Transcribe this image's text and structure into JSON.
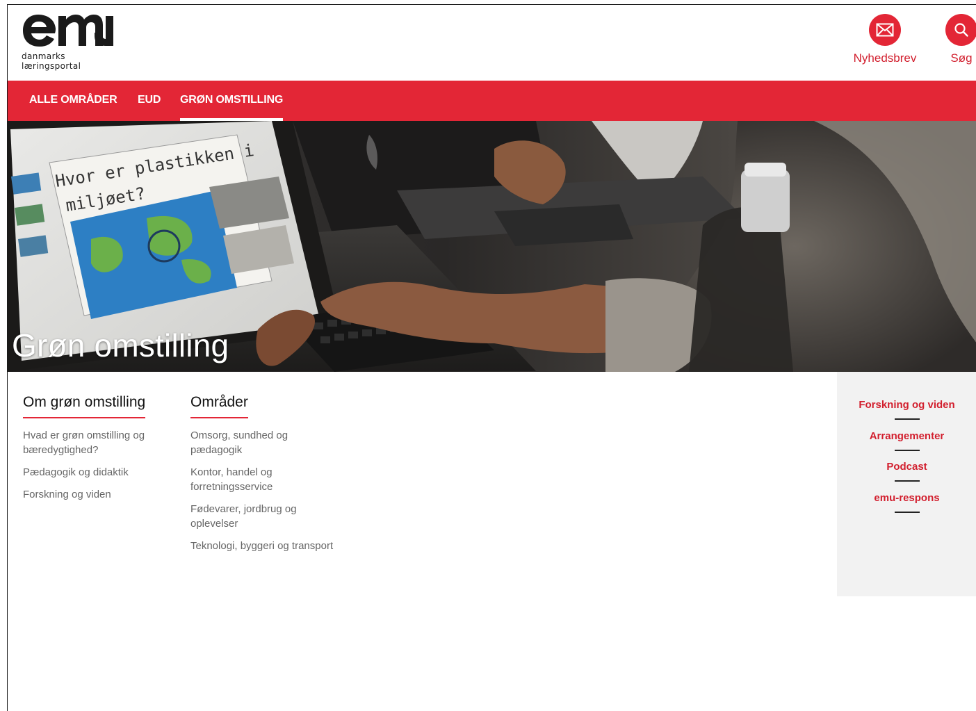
{
  "brand": {
    "logo_alt": "emu",
    "tagline": "danmarks læringsportal",
    "accent": "#e32636"
  },
  "header": {
    "newsletter_label": "Nyhedsbrev",
    "newsletter_icon": "envelope-icon",
    "search_label": "Søg",
    "search_icon": "search-icon"
  },
  "nav": {
    "items": [
      {
        "label": "ALLE OMRÅDER",
        "active": false
      },
      {
        "label": "EUD",
        "active": false
      },
      {
        "label": "GRØN OMSTILLING",
        "active": true
      }
    ]
  },
  "hero": {
    "title": "Grøn omstilling",
    "screen_text_line1": "Hvor er plastikken i",
    "screen_text_line2": "miljøet?"
  },
  "about": {
    "heading": "Om grøn omstilling",
    "links": [
      "Hvad er grøn omstilling og bæredygtighed?",
      "Pædagogik og didaktik",
      "Forskning og viden"
    ]
  },
  "areas": {
    "heading": "Områder",
    "links": [
      "Omsorg, sundhed og pædagogik",
      "Kontor, handel og forretningsservice",
      "Fødevarer, jordbrug og oplevelser",
      "Teknologi, byggeri og transport"
    ]
  },
  "sidebar": {
    "links": [
      "Forskning og viden",
      "Arrangementer",
      "Podcast",
      "emu-respons"
    ]
  }
}
